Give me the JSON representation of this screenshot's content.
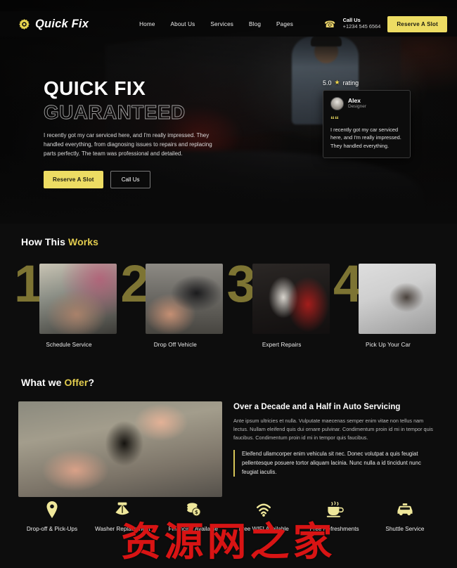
{
  "brand": {
    "name": "Quick Fix",
    "logo_icon": "gear-icon"
  },
  "nav": {
    "links": [
      {
        "label": "Home"
      },
      {
        "label": "About Us"
      },
      {
        "label": "Services"
      },
      {
        "label": "Blog"
      },
      {
        "label": "Pages"
      }
    ],
    "call_icon": "phone-icon",
    "call_label": "Call Us",
    "call_number": "+1234 545 6564",
    "cta_label": "Reserve A Slot"
  },
  "hero": {
    "title_line1": "QUICK FIX",
    "title_line2": "GUARANTEED",
    "paragraph": "I recently got my car serviced here, and I'm really impressed. They handled everything, from diagnosing issues to repairs and replacing parts perfectly. The team was professional and detailed.",
    "primary_btn": "Reserve A Slot",
    "secondary_btn": "Call Us",
    "rating_value": "5.0",
    "rating_star_icon": "star-icon",
    "rating_label": "rating",
    "testimonial": {
      "avatar_icon": "avatar-icon",
      "name": "Alex",
      "role": "Designer",
      "quote_icon": "quote-icon",
      "text": "I recently got my car serviced here, and I'm really impressed. They handled everything."
    }
  },
  "works": {
    "title_plain": "How This ",
    "title_accent": "Works",
    "steps": [
      {
        "number": "1",
        "label": "Schedule Service"
      },
      {
        "number": "2",
        "label": "Drop Off Vehicle"
      },
      {
        "number": "3",
        "label": "Expert Repairs"
      },
      {
        "number": "4",
        "label": "Pick Up Your Car"
      }
    ]
  },
  "offer": {
    "title_plain": "What we ",
    "title_accent": "Offer",
    "title_suffix": "?",
    "heading": "Over a Decade and a Half in Auto Servicing",
    "paragraph": "Ante ipsum ultricies et nulla. Vulputate maecenas semper enim vitae non tellus nam lectus. Nullam eleifend quis dui ornare pulvinar. Condimentum proin id mi in tempor quis faucibus. Condimentum proin id mi in tempor quis faucibus.",
    "quote": "Eleifend ullamcorper enim vehicula sit nec. Donec volutpat a quis feugiat pellentesque posuere tortor aliquam lacinia. Nunc nulla a id tincidunt nunc feugiat iaculis."
  },
  "features": [
    {
      "icon": "location-pin-icon",
      "label": "Drop-off & Pick-Ups"
    },
    {
      "icon": "washer-icon",
      "label": "Washer Replacement"
    },
    {
      "icon": "coins-icon",
      "label": "Financing Available"
    },
    {
      "icon": "wifi-icon",
      "label": "Free WIFI Available"
    },
    {
      "icon": "coffee-cup-icon",
      "label": "Free Refreshments"
    },
    {
      "icon": "taxi-icon",
      "label": "Shuttle Service"
    }
  ],
  "watermark": {
    "text": "资源网之家"
  },
  "colors": {
    "accent": "#eddc63",
    "accent_dark": "#847a36",
    "background": "#0d0d0d",
    "watermark": "#d81414"
  }
}
